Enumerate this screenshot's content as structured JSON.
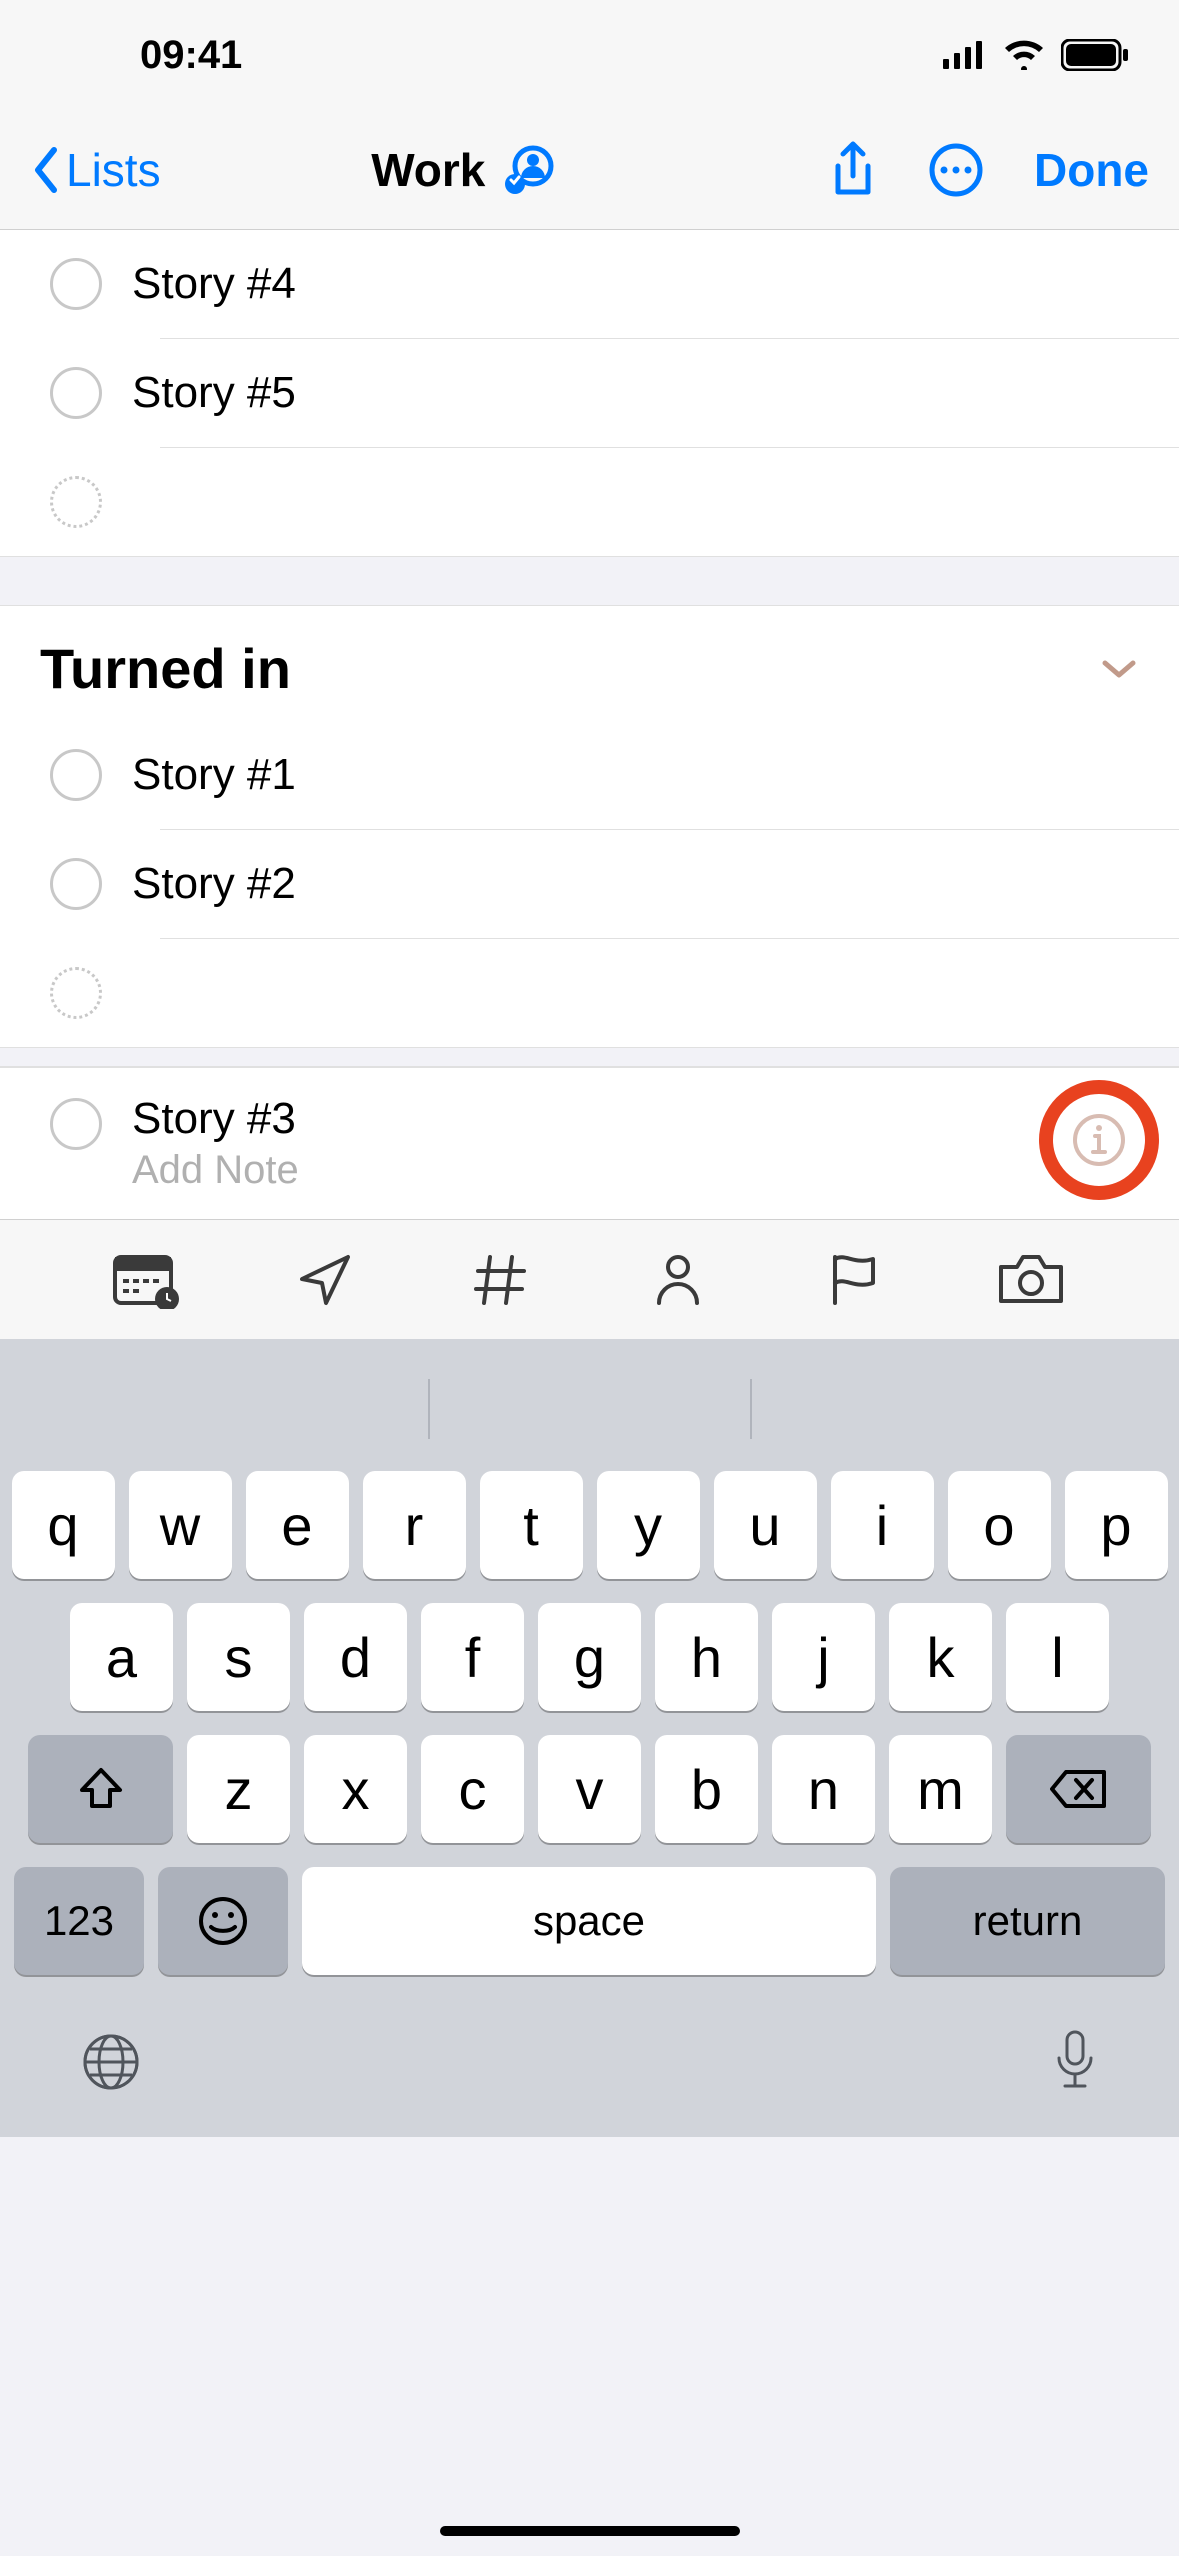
{
  "status": {
    "time": "09:41"
  },
  "nav": {
    "back": "Lists",
    "title": "Work",
    "done": "Done"
  },
  "top_items": [
    {
      "title": "Story #4"
    },
    {
      "title": "Story #5"
    }
  ],
  "section": {
    "title": "Turned in"
  },
  "section_items": [
    {
      "title": "Story #1"
    },
    {
      "title": "Story #2"
    }
  ],
  "editing": {
    "title": "Story #3",
    "note_placeholder": "Add Note"
  },
  "keyboard": {
    "row1": [
      "q",
      "w",
      "e",
      "r",
      "t",
      "y",
      "u",
      "i",
      "o",
      "p"
    ],
    "row2": [
      "a",
      "s",
      "d",
      "f",
      "g",
      "h",
      "j",
      "k",
      "l"
    ],
    "row3": [
      "z",
      "x",
      "c",
      "v",
      "b",
      "n",
      "m"
    ],
    "num": "123",
    "space": "space",
    "ret": "return"
  }
}
